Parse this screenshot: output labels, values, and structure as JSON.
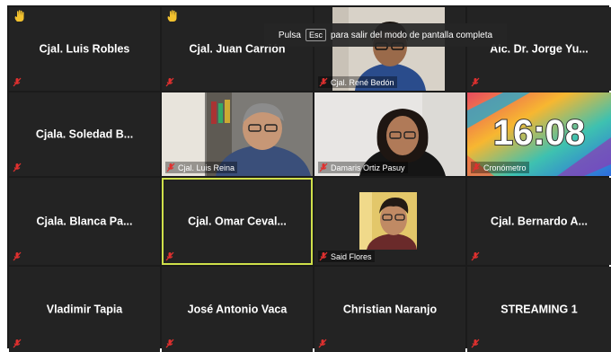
{
  "toast": {
    "prefix": "Pulsa",
    "key": "Esc",
    "suffix": "para salir del modo de pantalla completa"
  },
  "clock": {
    "time": "16:08"
  },
  "colors": {
    "tile_bg": "#232323",
    "active_border": "#cfe04a",
    "mute_red": "#e0302f",
    "hand_yellow": "#f2c12e"
  },
  "participants": [
    {
      "name": "Cjal. Luis Robles",
      "hand": true
    },
    {
      "name": "Cjal. Juan Carrión",
      "hand": true
    },
    {
      "name": "Cjal. René Bedón",
      "video": true
    },
    {
      "name": "Alc. Dr. Jorge Yu..."
    },
    {
      "name": "Cjala. Soledad B..."
    },
    {
      "name": "Cjal. Luis Reina",
      "video": true
    },
    {
      "name": "Damaris Ortiz Pasuy",
      "video": true
    },
    {
      "name": "Cronómetro",
      "video": true
    },
    {
      "name": "Cjala. Blanca Pa..."
    },
    {
      "name": "Cjal. Omar Ceval...",
      "active": true
    },
    {
      "name": "Said Flores",
      "video": true
    },
    {
      "name": "Cjal. Bernardo A..."
    },
    {
      "name": "Vladimir Tapia"
    },
    {
      "name": "José Antonio Vaca"
    },
    {
      "name": "Christian Naranjo"
    },
    {
      "name": "STREAMING 1"
    }
  ]
}
